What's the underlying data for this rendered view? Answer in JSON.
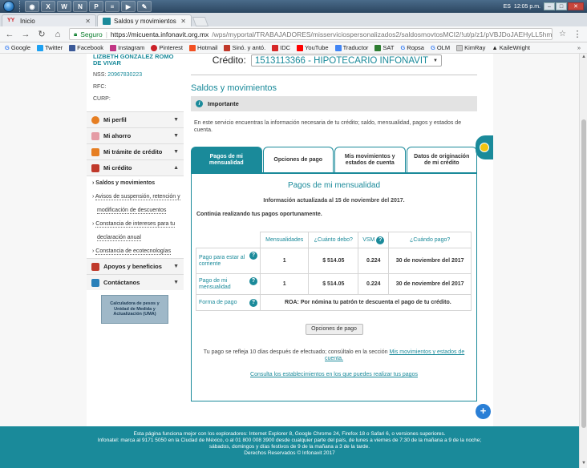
{
  "taskbar": {
    "lang": "ES",
    "time": "12:05 p.m."
  },
  "browser": {
    "tabs": [
      {
        "label": "Inicio",
        "icon": "infonavit-logo-icon"
      },
      {
        "label": "Saldos y movimientos",
        "icon": "page-icon"
      }
    ],
    "secure_label": "Seguro",
    "url_host": "https://micuenta.infonavit.org.mx",
    "url_path": "/wps/myportal/TRABAJADORES/misserviciospersonalizados2/saldosmovtosMCI2/!ut/p/z1/pVBJDoJAEHyLL5hmWGY8NiKNiAuC...",
    "bookmarks": [
      "Google",
      "Twitter",
      "Facebook",
      "Instagram",
      "Pinterest",
      "Hotmail",
      "Sinó. y antó.",
      "IDC",
      "YouTube",
      "Traductor",
      "SAT",
      "Ropsa",
      "OLM",
      "KimRay",
      "KaileWright"
    ]
  },
  "sidebar": {
    "user_name": "LIZBETH GONZALEZ ROMO DE VIVAR",
    "nss_label": "NSS:",
    "nss_value": "20967830223",
    "rfc_label": "RFC:",
    "curp_label": "CURP:",
    "menu": [
      {
        "label": "Mi perfil"
      },
      {
        "label": "Mi ahorro"
      },
      {
        "label": "Mi trámite de crédito"
      },
      {
        "label": "Mi crédito"
      }
    ],
    "submenu": [
      "Saldos y movimientos",
      "Avisos de suspensión, retención y",
      "modificación de descuentos",
      "Constancia de intereses para tu",
      "declaración anual",
      "Constancia de ecotecnologías"
    ],
    "menu2": [
      {
        "label": "Apoyos y beneficios"
      },
      {
        "label": "Contáctanos"
      }
    ],
    "calc_text": "Calculadora de pesos y Unidad de Medida y Actualización (UMA)"
  },
  "main": {
    "credito_label": "Crédito:",
    "credito_value": "1513113366 - HIPOTECARIO INFONAVIT",
    "page_title": "Saldos y movimientos",
    "important_label": "Importante",
    "intro": "En este servicio encuentras la información necesaria de tu crédito; saldo, mensualidad, pagos y estados de cuenta.",
    "tabs": [
      "Pagos de mi mensualidad",
      "Opciones de pago",
      "Mis movimientos y estados de cuenta",
      "Datos de originación de mi crédito"
    ],
    "panel_title": "Pagos de mi mensualidad",
    "updated": "Información actualizada al 15 de noviembre del 2017.",
    "continue": "Continúa realizando tus pagos oportunamente.",
    "table": {
      "headers": [
        "Mensualidades",
        "¿Cuánto debo?",
        "VSM",
        "¿Cuándo pago?"
      ],
      "rows": [
        {
          "label": "Pago para estar al corriente",
          "mens": "1",
          "debo": "$ 514.05",
          "vsm": "0.224",
          "cuando": "30 de noviembre del 2017"
        },
        {
          "label": "Pago de mi mensualidad",
          "mens": "1",
          "debo": "$ 514.05",
          "vsm": "0.224",
          "cuando": "30 de noviembre del 2017"
        }
      ],
      "forma_label": "Forma de pago",
      "forma_value": "ROA: Por nómina tu patrón te descuenta el pago de tu crédito."
    },
    "btn_opciones": "Opciones de pago",
    "note_text": "Tu pago se refleja 10 días después de efectuado; consúltalo en la sección ",
    "note_link": "Mis movimientos y estados de cuenta.",
    "link_establecimientos": "Consulta los establecimientos en los que puedes realizar tus pagos"
  },
  "footer": {
    "line1": "Esta página funciona mejor con los exploradores: Internet Explorer 8, Google Chrome 24, Firefox 18 o Safari 6, o versiones superiores.",
    "line2": "Infonatel: marca al 9171 5050 en la Ciudad de México, o al 01 800 008 3900 desde cualquier parte del país, de lunes a viernes de 7:30 de la mañana a 9 de la noche;",
    "line3": "sábados, domingos y días festivos de 9 de la mañana a 3 de la tarde.",
    "line4": "Derechos Reservados © Infonavit 2017"
  }
}
